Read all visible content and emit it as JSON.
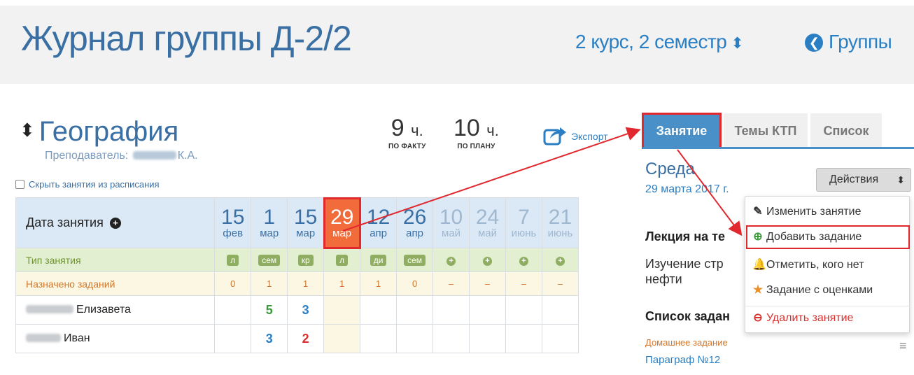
{
  "header": {
    "title": "Журнал группы Д-2/2",
    "semester": "2 курс, 2 семестр",
    "groups_link": "Группы"
  },
  "subject": {
    "name": "География",
    "teacher_prefix": "Преподаватель:",
    "teacher_initials": "К.А."
  },
  "hours": {
    "fact_value": "9",
    "fact_unit": "ч.",
    "fact_caption": "ПО ФАКТУ",
    "plan_value": "10",
    "plan_unit": "ч.",
    "plan_caption": "ПО ПЛАНУ"
  },
  "export_label": "Экспорт",
  "hide_lessons_label": "Скрыть занятия из расписания",
  "journal": {
    "date_header": "Дата занятия",
    "dates": [
      {
        "day": "15",
        "month": "фев"
      },
      {
        "day": "1",
        "month": "мар"
      },
      {
        "day": "15",
        "month": "мар"
      },
      {
        "day": "29",
        "month": "мар"
      },
      {
        "day": "12",
        "month": "апр"
      },
      {
        "day": "26",
        "month": "апр"
      },
      {
        "day": "10",
        "month": "май"
      },
      {
        "day": "24",
        "month": "май"
      },
      {
        "day": "7",
        "month": "июнь"
      },
      {
        "day": "21",
        "month": "июнь"
      }
    ],
    "selected_date_index": 3,
    "type_label": "Тип занятия",
    "types": [
      "л",
      "сем",
      "кр",
      "л",
      "ди",
      "сем",
      "+",
      "+",
      "+",
      "+"
    ],
    "assign_label": "Назначено заданий",
    "assignments": [
      "0",
      "1",
      "1",
      "1",
      "1",
      "0",
      "–",
      "–",
      "–",
      "–"
    ],
    "students": [
      {
        "first_name": "Елизавета",
        "grades": [
          "",
          "5",
          "3",
          "",
          "",
          "",
          "",
          "",
          "",
          ""
        ]
      },
      {
        "first_name": "Иван",
        "grades": [
          "",
          "3",
          "2",
          "",
          "",
          "",
          "",
          "",
          "",
          ""
        ]
      }
    ]
  },
  "panel": {
    "tabs": [
      "Занятие",
      "Темы КТП",
      "Список"
    ],
    "active_tab": "Занятие",
    "day_name": "Среда",
    "day_date": "29 марта 2017 г.",
    "actions_label": "Действия",
    "lesson_type": "Лекция на те",
    "lesson_topic": "Изучение стр нефти",
    "task_list_title": "Список задан",
    "task_type": "Домашнее задание",
    "task_name": "Параграф №12"
  },
  "dropdown": {
    "items": [
      {
        "label": "Изменить занятие",
        "icon": "pencil-icon",
        "color": "#333333"
      },
      {
        "label": "Добавить задание",
        "icon": "plus-circle-icon",
        "color": "#3a9a3a"
      },
      {
        "label": "Отметить, кого нет",
        "icon": "bell-icon",
        "color": "#e8902a"
      },
      {
        "label": "Задание с оценками",
        "icon": "star-icon",
        "color": "#e8902a"
      },
      {
        "label": "Удалить занятие",
        "icon": "minus-circle-icon",
        "color": "#d93030"
      }
    ]
  },
  "colors": {
    "accent": "#2a7fc4",
    "selected_date": "#f26b3a",
    "highlight_frame": "#e0282e",
    "tab_active": "#4a90c8"
  }
}
